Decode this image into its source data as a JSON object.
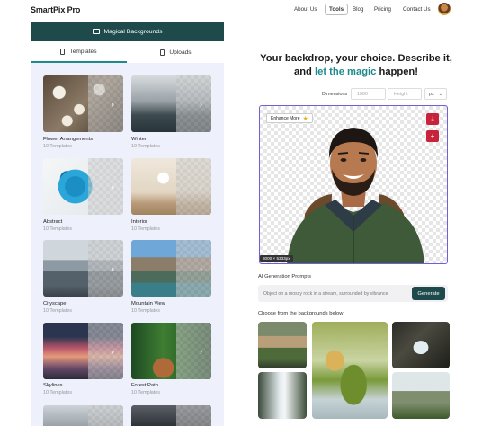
{
  "header": {
    "logo": "SmartPix Pro",
    "nav": [
      "About Us",
      "Tools",
      "Blog",
      "Pricing",
      "Contact Us"
    ]
  },
  "left": {
    "magic_label": "Magical Backgrounds",
    "tabs": [
      "Templates",
      "Uploads"
    ],
    "templates": [
      {
        "name": "Flower Arrangements",
        "count": "10 Templates"
      },
      {
        "name": "Winter",
        "count": "10 Templates"
      },
      {
        "name": "Abstract",
        "count": "10 Templates"
      },
      {
        "name": "Interior",
        "count": "10 Templates"
      },
      {
        "name": "Cityscape",
        "count": "10 Templates"
      },
      {
        "name": "Mountain View",
        "count": "10 Templates"
      },
      {
        "name": "Skylines",
        "count": "10 Templates"
      },
      {
        "name": "Forest Path",
        "count": "10 Templates"
      }
    ]
  },
  "right": {
    "headline_1": "Your backdrop, your choice. Describe it,",
    "headline_2a": "and ",
    "headline_2b": "let the magic",
    "headline_2c": " happen!",
    "dimensions_label": "Dimensions",
    "width_value": "1080",
    "height_placeholder": "Height",
    "unit": "px",
    "enhance_label": "Enhance More",
    "size_tag": "8000 × 5333px",
    "prompts_label": "AI Generation Prompts",
    "prompt_placeholder": "Object on a mossy rock in a stream, surrounded by vibrance",
    "generate_label": "Generate",
    "backgrounds_label": "Choose from the backgrounds below"
  },
  "colors": {
    "brand_dark": "#1f4a4b",
    "accent_teal": "#1f8a8c",
    "canvas_border": "#6f5fd8",
    "action_red": "#c8233b"
  }
}
